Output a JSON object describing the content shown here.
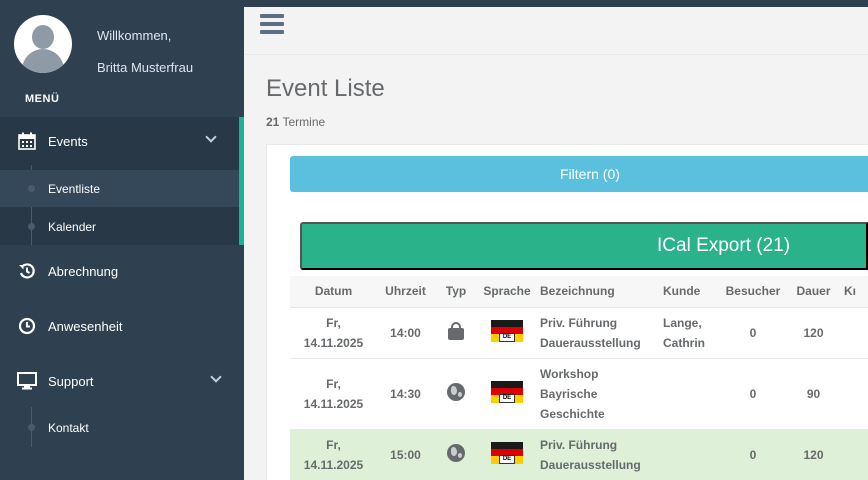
{
  "sidebar": {
    "welcome": "Willkommen,",
    "user_name": "Britta Musterfrau",
    "menu_title": "MENÜ",
    "items": [
      {
        "label": "Events",
        "icon": "calendar-icon"
      },
      {
        "label": "Abrechnung",
        "icon": "history-icon"
      },
      {
        "label": "Anwesenheit",
        "icon": "clock-icon"
      },
      {
        "label": "Support",
        "icon": "desktop-icon"
      }
    ],
    "events_sub": [
      {
        "label": "Eventliste"
      },
      {
        "label": "Kalender"
      }
    ],
    "support_sub": [
      {
        "label": "Kontakt"
      }
    ]
  },
  "header": {
    "menu_icon": "hamburger-icon"
  },
  "main": {
    "title": "Event Liste",
    "count": "21",
    "count_label": "Termine",
    "filter_button": "Filtern (0)",
    "ical_button": "ICal Export (21)"
  },
  "table": {
    "headers": [
      "Datum",
      "Uhrzeit",
      "Typ",
      "Sprache",
      "Bezeichnung",
      "Kunde",
      "Besucher",
      "Dauer",
      "Kı"
    ],
    "rows": [
      {
        "date_day": "Fr,",
        "date": "14.11.2025",
        "time": "14:00",
        "type_icon": "lock-icon",
        "lang": "DE",
        "name_1": "Priv. Führung",
        "name_2": "Dauerausstellung",
        "name_3": "",
        "customer_1": "Lange,",
        "customer_2": "Cathrin",
        "visitors": "0",
        "duration": "120",
        "highlight": false
      },
      {
        "date_day": "Fr,",
        "date": "14.11.2025",
        "time": "14:30",
        "type_icon": "globe-icon",
        "lang": "DE",
        "name_1": "Workshop",
        "name_2": "Bayrische",
        "name_3": "Geschichte",
        "customer_1": "",
        "customer_2": "",
        "visitors": "0",
        "duration": "90",
        "highlight": false
      },
      {
        "date_day": "Fr,",
        "date": "14.11.2025",
        "time": "15:00",
        "type_icon": "globe-icon",
        "lang": "DE",
        "name_1": "Priv. Führung",
        "name_2": "Dauerausstellung",
        "name_3": "",
        "customer_1": "",
        "customer_2": "",
        "visitors": "0",
        "duration": "120",
        "highlight": true
      }
    ]
  },
  "colors": {
    "sidebar_bg": "#2f4050",
    "accent": "#1ab394",
    "filter_btn": "#5bc0de",
    "ical_btn": "#2ab28b",
    "highlight_row": "#dff0d8"
  }
}
